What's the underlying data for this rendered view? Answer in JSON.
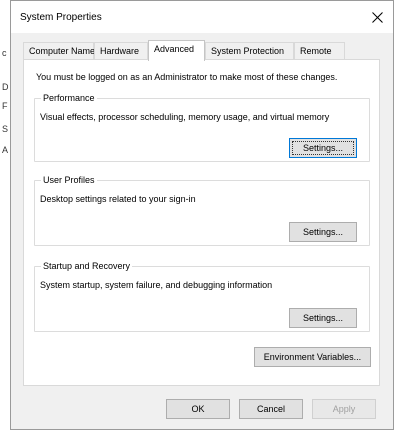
{
  "window": {
    "title": "System Properties"
  },
  "tabs": [
    {
      "label": "Computer Name"
    },
    {
      "label": "Hardware"
    },
    {
      "label": "Advanced"
    },
    {
      "label": "System Protection"
    },
    {
      "label": "Remote"
    }
  ],
  "advanced": {
    "intro": "You must be logged on as an Administrator to make most of these changes.",
    "performance": {
      "title": "Performance",
      "description": "Visual effects, processor scheduling, memory usage, and virtual memory",
      "button": "Settings..."
    },
    "user_profiles": {
      "title": "User Profiles",
      "description": "Desktop settings related to your sign-in",
      "button": "Settings..."
    },
    "startup_recovery": {
      "title": "Startup and Recovery",
      "description": "System startup, system failure, and debugging information",
      "button": "Settings..."
    },
    "env_button": "Environment Variables..."
  },
  "footer": {
    "ok": "OK",
    "cancel": "Cancel",
    "apply": "Apply"
  },
  "background_letters": {
    "c": "c",
    "d": "D",
    "f": "F",
    "s": "S",
    "a": "A"
  }
}
